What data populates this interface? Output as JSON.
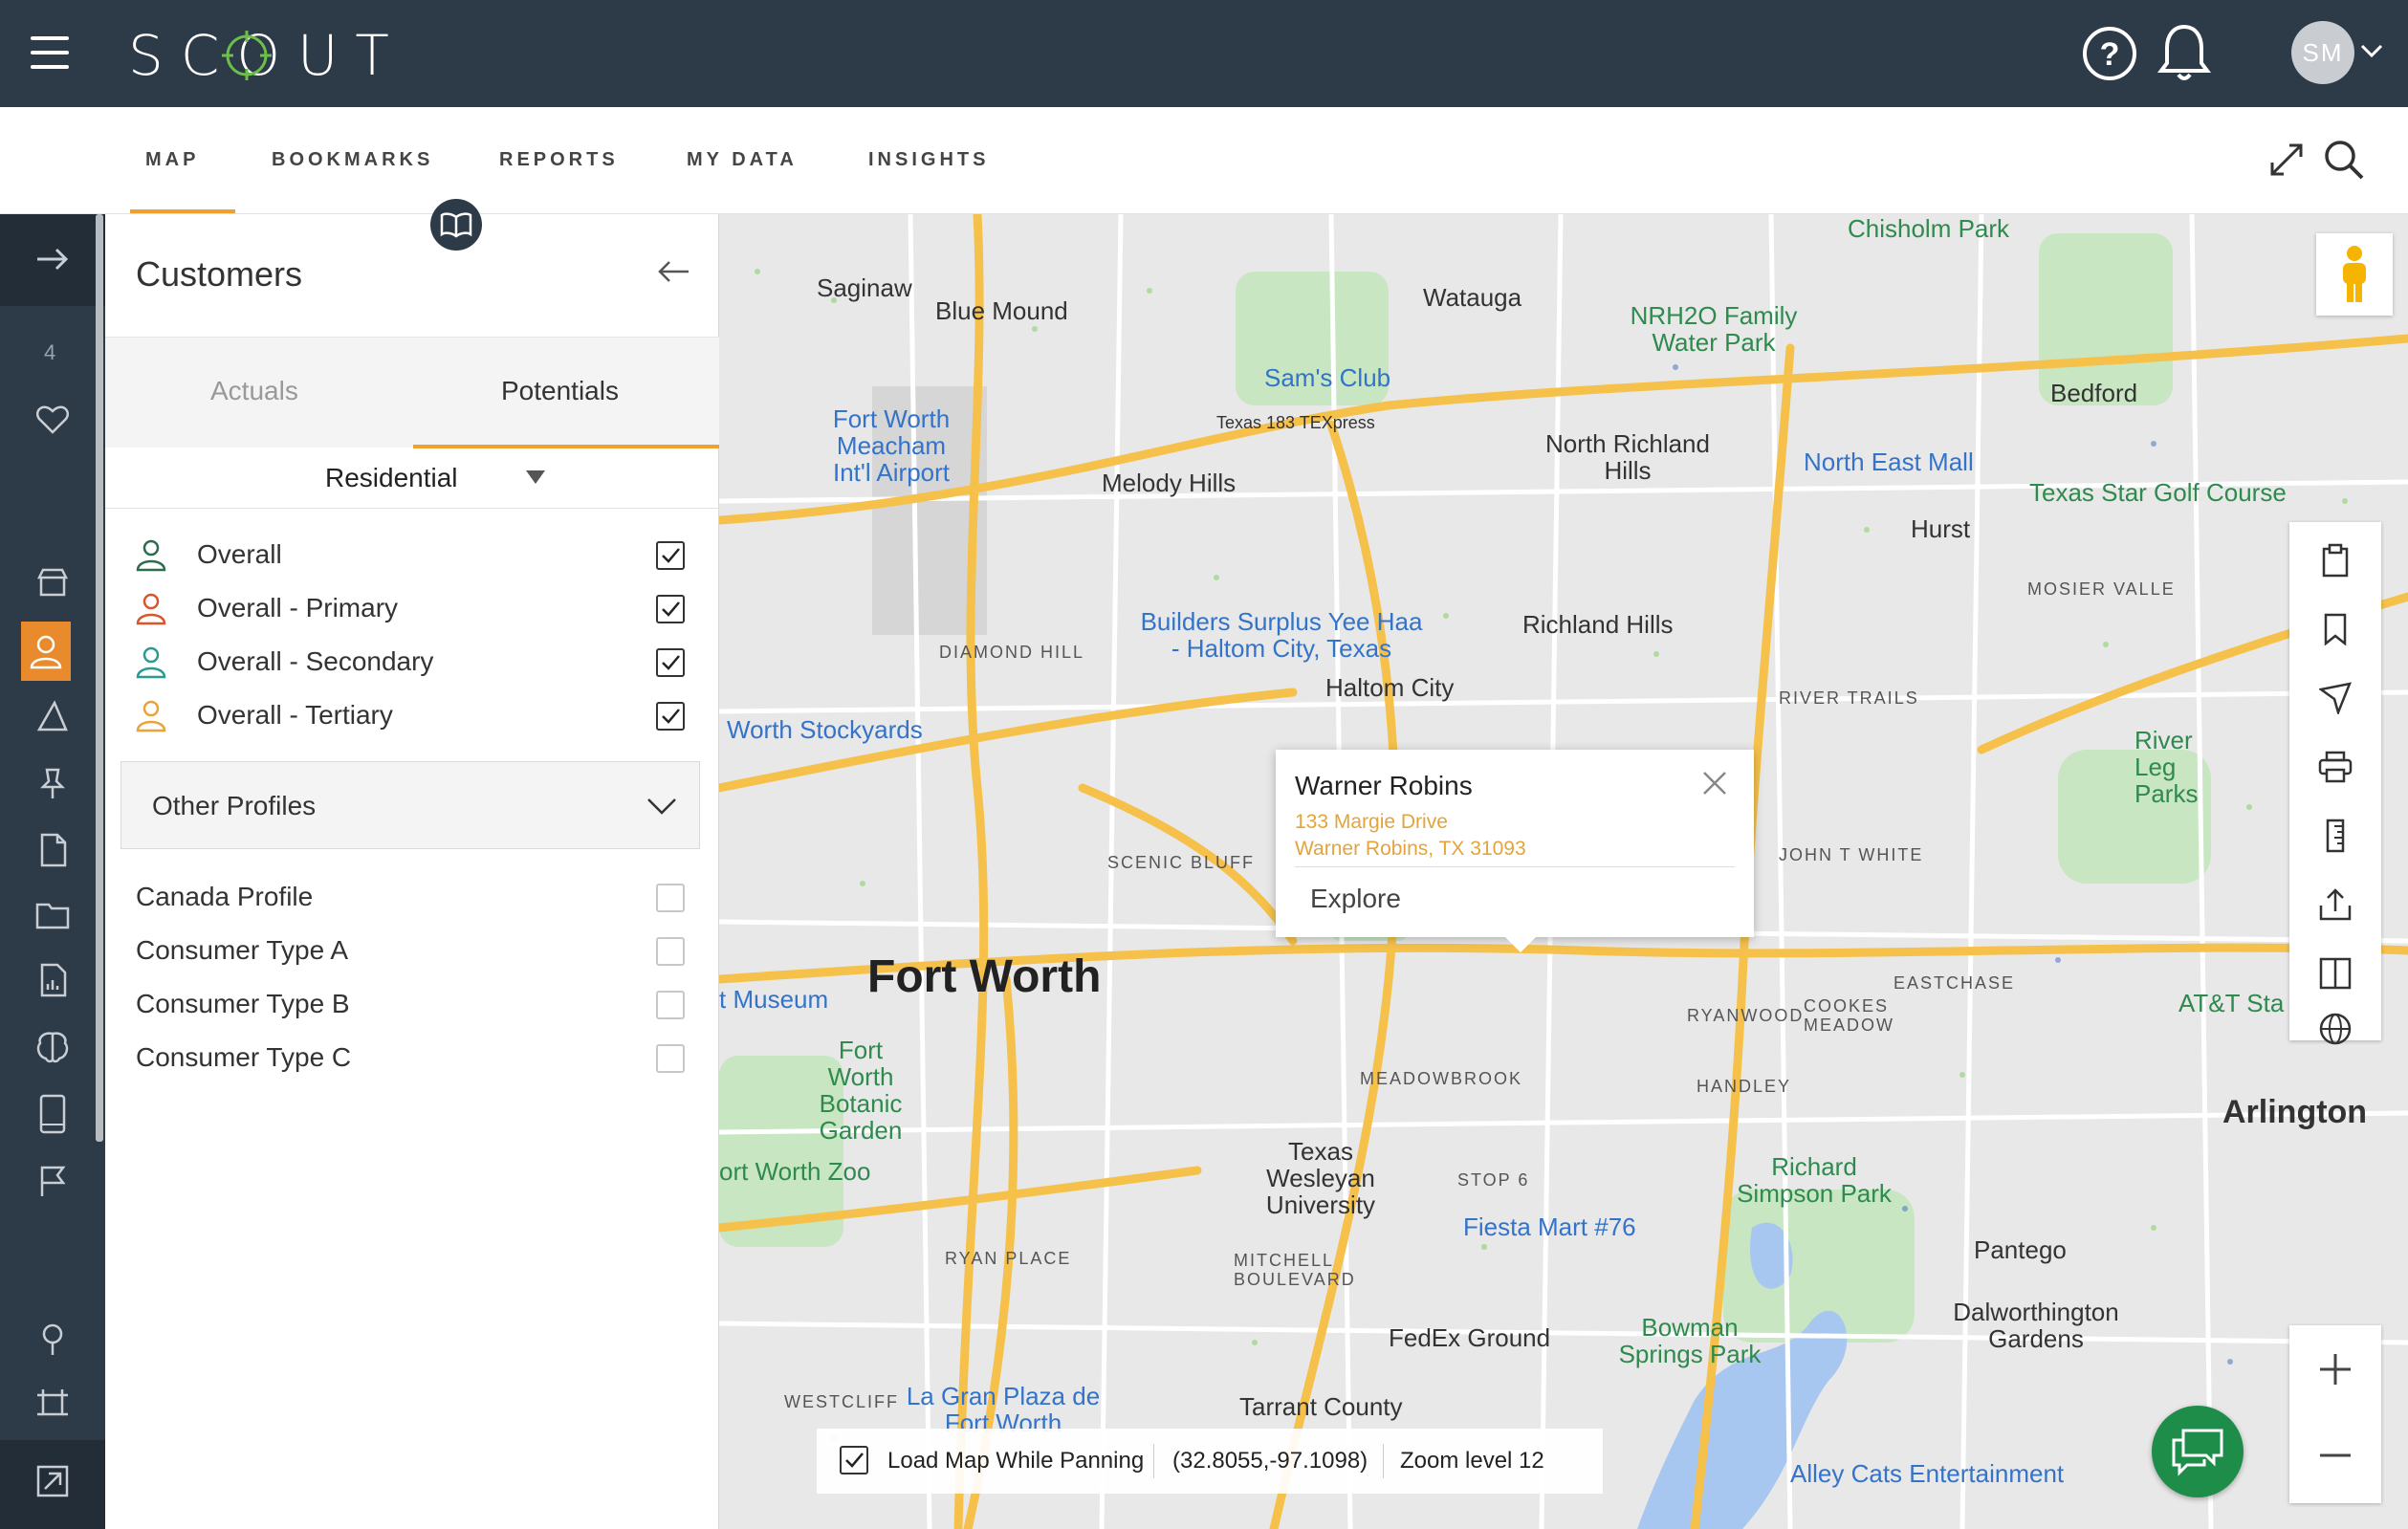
{
  "app": {
    "logo_text": "SCOUT",
    "user_initials": "SM"
  },
  "colors": {
    "topbar": "#2d3a47",
    "accent": "#f0a02f",
    "active_rail": "#e98a2c",
    "chat": "#1e8d4a",
    "address": "#e3a43c"
  },
  "nav": {
    "tabs": [
      {
        "label": "MAP",
        "active": true
      },
      {
        "label": "BOOKMARKS"
      },
      {
        "label": "REPORTS"
      },
      {
        "label": "MY DATA"
      },
      {
        "label": "INSIGHTS"
      }
    ]
  },
  "rail": {
    "count": "4",
    "icons": [
      "arrow-right-icon",
      "heart-icon",
      "store-icon",
      "person-icon",
      "shape-icon",
      "pin-icon",
      "file-icon",
      "folder-icon",
      "report-icon",
      "brain-icon",
      "tablet-icon",
      "flag-icon",
      "location-icon",
      "frame-icon",
      "export-icon"
    ]
  },
  "panel": {
    "title": "Customers",
    "subtabs": [
      "Actuals",
      "Potentials"
    ],
    "active_subtab": "Potentials",
    "dropdown_value": "Residential",
    "profiles": [
      {
        "label": "Overall",
        "checked": true,
        "color": "#2f6b4f"
      },
      {
        "label": "Overall - Primary",
        "checked": true,
        "color": "#d9552b"
      },
      {
        "label": "Overall - Secondary",
        "checked": true,
        "color": "#2a9a92"
      },
      {
        "label": "Overall - Tertiary",
        "checked": true,
        "color": "#e9a33a"
      }
    ],
    "other_profiles_label": "Other Profiles",
    "other_profiles": [
      {
        "label": "Canada Profile",
        "checked": false
      },
      {
        "label": "Consumer Type A",
        "checked": false
      },
      {
        "label": "Consumer Type B",
        "checked": false
      },
      {
        "label": "Consumer Type C",
        "checked": false
      }
    ]
  },
  "map": {
    "labels": {
      "fort_worth": "Fort Worth",
      "saginaw": "Saginaw",
      "blue_mound": "Blue Mound",
      "watauga": "Watauga",
      "melody_hills": "Melody Hills",
      "north_richland_hills": "North Richland Hills",
      "richland_hills": "Richland Hills",
      "haltom_city": "Haltom City",
      "hurst": "Hurst",
      "bedford": "Bedford",
      "arlington": "Arlington",
      "pantego": "Pantego",
      "dalworthington": "Dalworthington Gardens",
      "chisholm_park": "Chisholm Park",
      "nrh2o": "NRH2O Family Water Park",
      "sams_club": "Sam's Club",
      "north_east_mall": "North East Mall",
      "texas_star": "Texas Star Golf Course",
      "meacham": "Fort Worth Meacham Int'l Airport",
      "builders": "Builders Surplus Yee Haa - Haltom City, Texas",
      "stockyards": "Worth Stockyards",
      "museum": "t Museum",
      "botanic": "Fort Worth Botanic Garden",
      "zoo": "ort Worth Zoo",
      "twu": "Texas Wesleyan University",
      "fiesta": "Fiesta Mart #76",
      "fedex": "FedEx Ground",
      "richard_simpson": "Richard Simpson Park",
      "bowman": "Bowman Springs Park",
      "la_gran_plaza": "La Gran Plaza de Fort Worth",
      "tarrant": "Tarrant County",
      "alley_cats": "Alley Cats Entertainment",
      "river_legacy": "River Leg Parks",
      "att": "AT&T Sta",
      "diamond_hill": "DIAMOND HILL",
      "scenic_bluff": "SCENIC BLUFF",
      "river_trails": "RIVER TRAILS",
      "john_t_white": "JOHN T WHITE",
      "eastchase": "EASTCHASE",
      "ryanwood": "RYANWOOD",
      "cookes_meadow": "COOKES MEADOW",
      "handley": "HANDLEY",
      "meadowbrook": "MEADOWBROOK",
      "stop_6": "STOP 6",
      "ryan_place": "RYAN PLACE",
      "mitchell_blvd": "MITCHELL BOULEVARD",
      "westcliff": "WESTCLIFF",
      "mosier_valley": "MOSIER VALLE",
      "texas_183": "Texas 183 TEXpress"
    },
    "popup": {
      "title": "Warner Robins",
      "address_line1": "133 Margie Drive",
      "address_line2": "Warner Robins, TX 31093",
      "action": "Explore"
    },
    "status": {
      "load_label": "Load Map While Panning",
      "load_checked": true,
      "coords": "(32.8055,-97.1098)",
      "zoom": "Zoom level 12"
    },
    "tools": [
      "clipboard-icon",
      "bookmark-icon",
      "cursor-icon",
      "print-icon",
      "ruler-icon",
      "share-icon",
      "split-view-icon",
      "globe-icon"
    ]
  }
}
